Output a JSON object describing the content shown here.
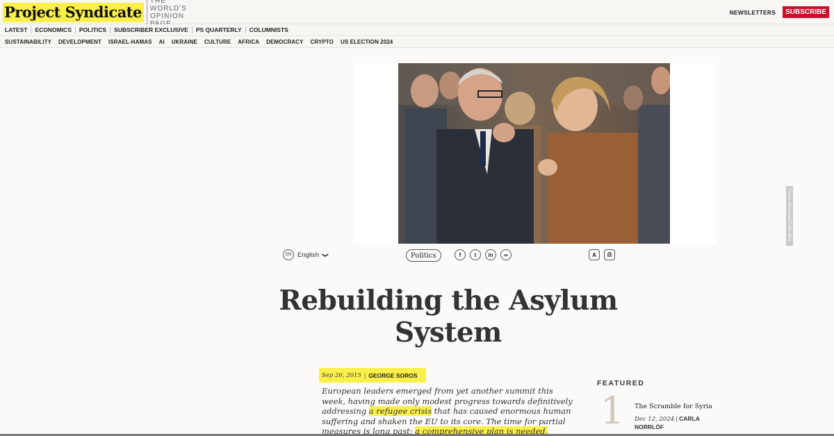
{
  "header": {
    "logo": "Project Syndicate",
    "tagline_1": "THE WORLD'S",
    "tagline_2": "OPINION PAGE",
    "newsletters": "NEWSLETTERS",
    "subscribe": "SUBSCRIBE"
  },
  "nav_primary": [
    "LATEST",
    "ECONOMICS",
    "POLITICS",
    "SUBSCRIBER EXCLUSIVE",
    "PS QUARTERLY",
    "COLUMNISTS"
  ],
  "nav_secondary": [
    "SUSTAINABILITY",
    "DEVELOPMENT",
    "ISRAEL-HAMAS",
    "AI",
    "UKRAINE",
    "CULTURE",
    "AFRICA",
    "DEMOCRACY",
    "CRYPTO",
    "US ELECTION 2024"
  ],
  "photo_credit": "Thierry Monasse/ZUMA Wire",
  "toolbar": {
    "lang_code": "EN",
    "lang_label": "English",
    "chevron": "❯",
    "category": "Politics",
    "share": [
      "f",
      "t",
      "in",
      "∞"
    ],
    "tools": [
      "A",
      "⎙"
    ]
  },
  "article": {
    "title_line1": "Rebuilding the Asylum",
    "title_line2": "System",
    "date": "Sep 26, 2015",
    "separator": "|",
    "author": "GEORGE SOROS",
    "lead_1": "European leaders emerged from yet another summit this week, having made only modest progress towards definitively addressing ",
    "lead_hl1": "a refugee crisis",
    "lead_2": " that has caused enormous human suffering and shaken the EU to its core. The time for partial measures is long past; ",
    "lead_hl2": "a comprehensive plan is needed."
  },
  "featured": {
    "heading": "FEATURED",
    "number": "1",
    "title": "The Scramble for Syria",
    "date": "Dec 12, 2024",
    "separator": "|",
    "author": "CARLA NORRLÖF"
  },
  "colors": {
    "highlight": "#fbf04a",
    "subscribe": "#c8102e"
  }
}
